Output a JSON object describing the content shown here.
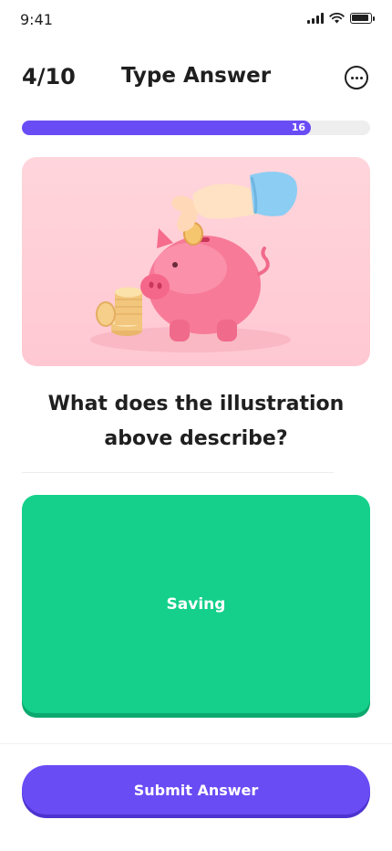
{
  "status_bar": {
    "time": "9:41"
  },
  "header": {
    "counter": "4/10",
    "title": "Type Answer",
    "more_icon": "more-horizontal-icon"
  },
  "progress": {
    "value": 0.83,
    "label": "16"
  },
  "illustration": {
    "subject": "piggy-bank-illustration"
  },
  "question": {
    "text": "What does the illustration above describe?"
  },
  "answer": {
    "value": "Saving"
  },
  "footer": {
    "submit_label": "Submit Answer"
  },
  "colors": {
    "primary": "#6a4cf5",
    "answer_bg": "#14d08a",
    "illustration_bg": "#ffc8d2"
  }
}
